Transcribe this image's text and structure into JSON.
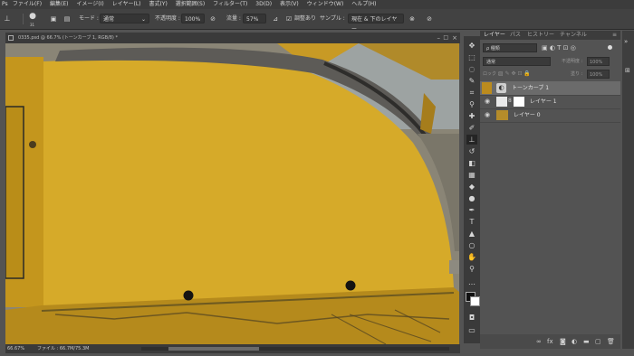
{
  "menubar": {
    "logo": "Ps",
    "items": [
      "ファイル(F)",
      "編集(E)",
      "イメージ(I)",
      "レイヤー(L)",
      "書式(Y)",
      "選択範囲(S)",
      "フィルター(T)",
      "3D(D)",
      "表示(V)",
      "ウィンドウ(W)",
      "ヘルプ(H)"
    ]
  },
  "options": {
    "brush_size": "31",
    "mode_label": "モード :",
    "mode_value": "通常",
    "opacity_label": "不透明度 :",
    "opacity_value": "100%",
    "flow_label": "流量 :",
    "flow_value": "57%",
    "aligned_label": "調整あり",
    "sample_label": "サンプル :",
    "sample_value": "現在 & 下のレイヤー"
  },
  "document": {
    "tab_title": "0335.psd @ 66.7% (トーンカーブ 1, RGB/8) *",
    "zoom": "66.67%",
    "file_info": "ファイル : 66.7M/75.3M"
  },
  "panel": {
    "tabs": [
      "レイヤー",
      "パス",
      "ヒストリー",
      "チャンネル"
    ],
    "kind_label": "ρ 種類",
    "blend_mode": "通常",
    "opacity_label": "不透明度 :",
    "opacity_value": "100%",
    "lock_label": "ロック :",
    "fill_label": "塗り :",
    "fill_value": "100%",
    "layers": [
      "トーンカーブ 1",
      "レイヤー 1",
      "レイヤー 0"
    ]
  },
  "colors": {
    "accent": "#3c7bd6",
    "yellow": "#d0a020"
  }
}
